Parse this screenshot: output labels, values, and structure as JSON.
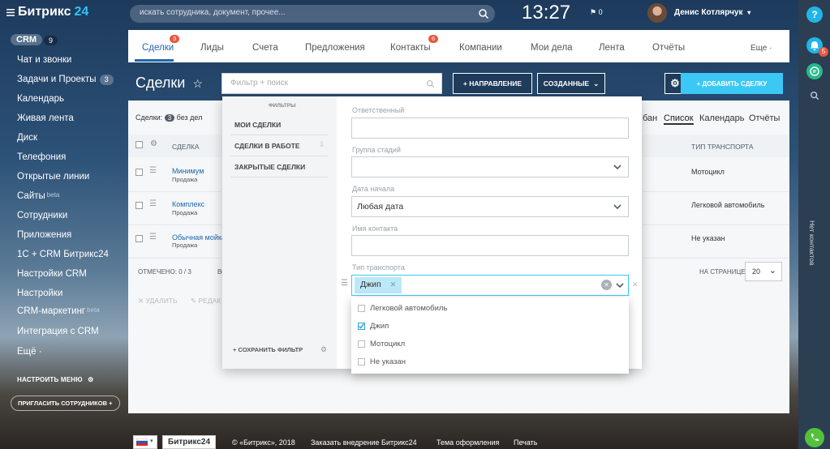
{
  "sidebar": {
    "logo_main": "Битрикс",
    "logo_num": "24",
    "crm_label": "CRM",
    "crm_count": "9",
    "items": [
      {
        "label": "Чат и звонки"
      },
      {
        "label": "Задачи и Проекты",
        "badge": "3"
      },
      {
        "label": "Календарь"
      },
      {
        "label": "Живая лента"
      },
      {
        "label": "Диск"
      },
      {
        "label": "Телефония"
      },
      {
        "label": "Открытые линии"
      },
      {
        "label": "Сайты",
        "sup": "beta"
      },
      {
        "label": "Сотрудники"
      },
      {
        "label": "Приложения"
      },
      {
        "label": "1С + CRM Битрикс24"
      },
      {
        "label": "Настройки CRM"
      },
      {
        "label": "Настройки"
      },
      {
        "label": "CRM-маркетинг",
        "sup": "beta"
      },
      {
        "label": "Интеграция с CRM"
      },
      {
        "label": "Ещё ·"
      }
    ],
    "menu_settings": "НАСТРОИТЬ МЕНЮ",
    "invite": "ПРИГЛАСИТЬ СОТРУДНИКОВ"
  },
  "topbar": {
    "search_placeholder": "искать сотрудника, документ, прочее...",
    "time": "13:27",
    "flag_count": "0",
    "user_name": "Денис Котлярчук"
  },
  "tabs": [
    {
      "label": "Сделки",
      "badge": "3"
    },
    {
      "label": "Лиды"
    },
    {
      "label": "Счета"
    },
    {
      "label": "Предложения"
    },
    {
      "label": "Контакты",
      "badge": "6"
    },
    {
      "label": "Компании"
    },
    {
      "label": "Мои дела"
    },
    {
      "label": "Лента"
    },
    {
      "label": "Отчёты"
    },
    {
      "label": "Еще ·"
    }
  ],
  "header": {
    "title": "Сделки",
    "filter_placeholder": "Фильтр + поиск",
    "direction_btn": "+ НАПРАВЛЕНИЕ",
    "created_btn": "СОЗДАННЫЕ",
    "add_deal": "+ ДОБАВИТЬ СДЕЛКУ"
  },
  "grid": {
    "summary_label": "Сделки:",
    "summary_count": "3",
    "summary_suffix": "без дел",
    "views": [
      "бан",
      "Список",
      "Календарь",
      "Отчёты"
    ],
    "col_deal": "СДЕЛКА",
    "col_transport": "ТИП ТРАНСПОРТА",
    "rows": [
      {
        "name": "Минимум",
        "stage": "Продажа",
        "transport": "Мотоцикл"
      },
      {
        "name": "Комплекс",
        "stage": "Продажа",
        "transport": "Легковой автомобиль"
      },
      {
        "name": "Обычная мойка",
        "stage": "Продажа",
        "transport": "Не указан"
      }
    ],
    "selected": "ОТМЕЧЕНО: 0 / 3",
    "all_label": "ВС",
    "per_page_label": "НА СТРАНИЦЕ:",
    "per_page": "20",
    "delete": "УДАЛИТЬ",
    "edit": "РЕДАК"
  },
  "filter": {
    "presets_title": "ФИЛЬТРЫ",
    "presets": [
      "МОИ СДЕЛКИ",
      "СДЕЛКИ В РАБОТЕ",
      "ЗАКРЫТЫЕ СДЕЛКИ"
    ],
    "save_filter": "СОХРАНИТЬ ФИЛЬТР",
    "fields": [
      {
        "label": "Ответственный",
        "value": ""
      },
      {
        "label": "Группа стадий",
        "value": ""
      },
      {
        "label": "Дата начала",
        "value": "Любая дата"
      },
      {
        "label": "Имя контакта",
        "value": ""
      },
      {
        "label": "Тип транспорта",
        "value": ""
      }
    ],
    "transport_tag": "Джип",
    "options": [
      {
        "label": "Легковой автомобиль",
        "checked": false
      },
      {
        "label": "Джип",
        "checked": true
      },
      {
        "label": "Мотоцикл",
        "checked": false
      },
      {
        "label": "Не указан",
        "checked": false
      }
    ]
  },
  "right_panel": {
    "help": "?",
    "notif_count": "5",
    "no_contacts": "Нет контактов"
  },
  "footer": {
    "brand": "Битрикс24",
    "copyright": "© «Битрикс», 2018",
    "order": "Заказать внедрение Битрикс24",
    "theme": "Тема оформления",
    "print": "Печать"
  }
}
